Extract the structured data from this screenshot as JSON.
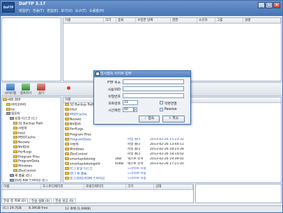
{
  "app": {
    "logo": "DaFTP",
    "title": "DaFTP 3.17"
  },
  "menu": [
    "파일(F)",
    "편집(E)",
    "보기(V)",
    "도구(T)",
    "도움말(H)"
  ],
  "menu_full": [
    "파일(F)",
    "전송(T)",
    "편집(E)",
    "보기(V)",
    "도구(T)",
    "도움말(H)"
  ],
  "window_buttons": {
    "minimize": "_",
    "maximize": "□",
    "close": "×"
  },
  "remote_header": [
    "이름",
    "크기",
    "종류",
    "수정한 날짜",
    "권한",
    "소유자",
    "그룹",
    "설명"
  ],
  "toolbar": {
    "site_button": "사이트맵",
    "connect_button": "접속하기",
    "disconnect_button": "끊기"
  },
  "local_tree": {
    "items": [
      {
        "label": "바탕 화면",
        "indent": 0,
        "icon": "folder"
      },
      {
        "label": "라이브러리",
        "indent": 1,
        "icon": "folder"
      },
      {
        "label": "tsi",
        "indent": 1,
        "icon": "folder"
      },
      {
        "label": "컴퓨터",
        "indent": 1,
        "icon": "drive"
      },
      {
        "label": "로컬 디스크 (C:)",
        "indent": 2,
        "icon": "drive"
      },
      {
        "label": "32 Backup Path",
        "indent": 3,
        "icon": "folder"
      },
      {
        "label": "사용자",
        "indent": 3,
        "icon": "folder"
      },
      {
        "label": "Intel",
        "indent": 3,
        "icon": "folder"
      },
      {
        "label": "MSOCache",
        "indent": 3,
        "icon": "folder"
      },
      {
        "label": "Neowiz",
        "indent": 3,
        "icon": "folder"
      },
      {
        "label": "NVIDIA",
        "indent": 3,
        "icon": "folder"
      },
      {
        "label": "PerfLogs",
        "indent": 3,
        "icon": "folder"
      },
      {
        "label": "Program Files",
        "indent": 3,
        "icon": "folder"
      },
      {
        "label": "ProgramData",
        "indent": 3,
        "icon": "folder"
      },
      {
        "label": "Windows",
        "indent": 3,
        "icon": "folder"
      },
      {
        "label": "ZboControl",
        "indent": 3,
        "icon": "folder"
      },
      {
        "label": "새 볼륨 (D:)",
        "indent": 2,
        "icon": "drive"
      },
      {
        "label": "DVD RW 드라이브 (E:)",
        "indent": 2,
        "icon": "drive"
      }
    ]
  },
  "local_files": {
    "header": [
      "이름",
      "크기",
      "종류",
      "수정한 날짜"
    ],
    "rows": [
      {
        "name": "32 Backup Path",
        "size": "",
        "type": "",
        "date": "",
        "blue": false
      },
      {
        "name": "Intel",
        "size": "",
        "type": "",
        "date": "",
        "blue": false
      },
      {
        "name": "MSOCache",
        "size": "",
        "type": "",
        "date": "",
        "blue": true
      },
      {
        "name": "Neowiz",
        "size": "",
        "type": "",
        "date": "",
        "blue": false
      },
      {
        "name": "NVIDIA",
        "size": "",
        "type": "",
        "date": "",
        "blue": false
      },
      {
        "name": "PerfLogs",
        "size": "",
        "type": "",
        "date": "",
        "blue": false
      },
      {
        "name": "Program Files",
        "size": "",
        "type": "",
        "date": "",
        "blue": false
      },
      {
        "name": "ProgramData",
        "size": "",
        "type": "파일 폴더",
        "date": "2013-02-26 15:23:32",
        "blue": true
      },
      {
        "name": "사용자",
        "size": "",
        "type": "파일 폴더",
        "date": "2013-02-26 13:44:11",
        "blue": false
      },
      {
        "name": "Windows",
        "size": "",
        "type": "파일 폴더",
        "date": "2013-02-26 18:23:28",
        "blue": false
      },
      {
        "name": "ZboControl",
        "size": "",
        "type": "파일 폴더",
        "date": "2013-02-26 18:14:02",
        "blue": false
      },
      {
        "name": "smartupdatelog",
        "size": "1KB",
        "type": "텍스트 문서",
        "date": "2013-02-26 19:39:02",
        "blue": false
      },
      {
        "name": "smartupdatelogold",
        "size": "65KB",
        "type": "텍스트 문서",
        "date": "2013-02-26 17:21:20",
        "blue": false
      },
      {
        "name": "[C:] 로컬 디스크",
        "size": "",
        "type": "드라이브 이동",
        "date": "",
        "blue": true
      },
      {
        "name": "[D:] 새 볼륨",
        "size": "",
        "type": "드라이브 이동",
        "date": "",
        "blue": true
      },
      {
        "name": "[E:] DVD-ROM 드라이브",
        "size": "",
        "type": "드라이브 이동",
        "date": "",
        "blue": true
      }
    ]
  },
  "queue_header": [
    "이름",
    "호스트디렉터리",
    "로컬디렉터리",
    "크기",
    "상태"
  ],
  "queue_tabs": [
    "전송 중 목록 (0)",
    "전송 실패 (0)",
    "전송 성공 (0)"
  ],
  "status": {
    "path": "(C:) 29.7GB",
    "free": "8.39GB free",
    "count": "12 개체 (1.00KB)"
  },
  "dialog": {
    "title": "임시접속 사이트 입력",
    "fields": {
      "ftp_label": "FTP 주소",
      "user_label": "사용자ID",
      "password_label": "비밀번호",
      "port_label": "포트번호",
      "port_value": "21",
      "timeout_label": "시간제한",
      "timeout_value": "60",
      "anonymous_label": "익명연결",
      "passive_label": "Passive"
    },
    "ok": "접속",
    "cancel": "취소"
  },
  "colors": {
    "title_bar": "#4675b5",
    "dialog_title": "#4f7fc0",
    "link_blue": "#2450c8"
  }
}
